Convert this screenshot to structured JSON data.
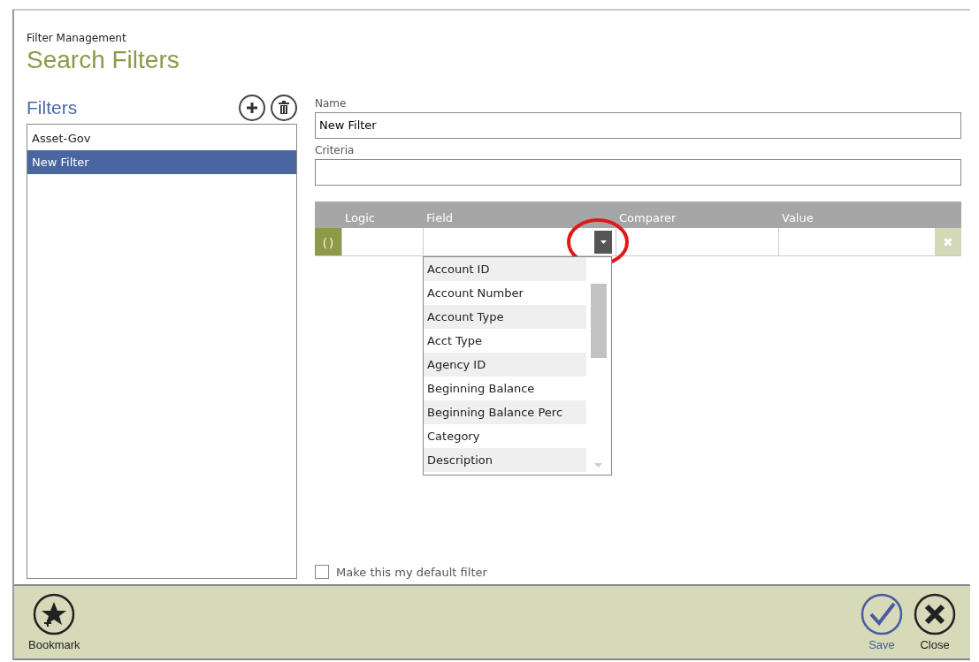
{
  "header": {
    "subtitle": "Filter Management",
    "title": "Search Filters"
  },
  "filters": {
    "title": "Filters",
    "items": [
      {
        "label": "Asset-Gov",
        "selected": false
      },
      {
        "label": "New Filter",
        "selected": true
      }
    ]
  },
  "form": {
    "name_label": "Name",
    "name_value": "New Filter",
    "criteria_label": "Criteria"
  },
  "grid": {
    "columns": [
      "Logic",
      "Field",
      "Comparer",
      "Value"
    ],
    "group_button": "( )",
    "remove_button": "✖"
  },
  "field_dropdown": {
    "options": [
      "Account ID",
      "Account Number",
      "Account Type",
      "Acct Type",
      "Agency ID",
      "Beginning Balance",
      "Beginning Balance Perc",
      "Category",
      "Description"
    ]
  },
  "default_checkbox": {
    "label": "Make this my default filter",
    "checked": false
  },
  "footer": {
    "left": [
      {
        "label": "Bookmark",
        "kind": "bookmark"
      }
    ],
    "right": [
      {
        "label": "Save",
        "kind": "save"
      },
      {
        "label": "Close",
        "kind": "close"
      }
    ]
  }
}
